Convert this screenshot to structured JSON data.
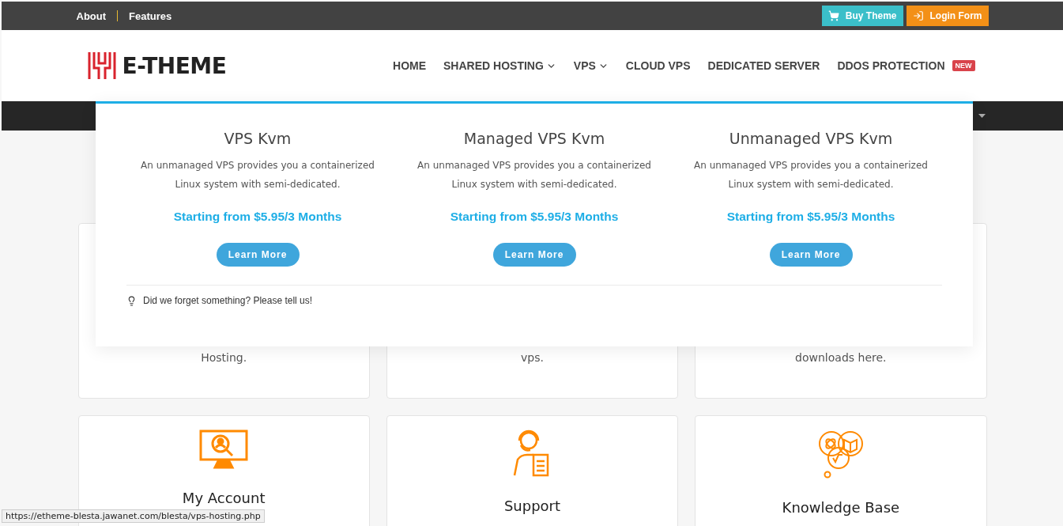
{
  "top_bar": {
    "links": [
      "About",
      "Features"
    ],
    "buttons": [
      {
        "label": "Buy Theme",
        "kind": "cart"
      },
      {
        "label": "Login Form",
        "kind": "login"
      }
    ]
  },
  "header": {
    "logo": "E-THEME",
    "nav": [
      {
        "label": "HOME",
        "dropdown": false
      },
      {
        "label": "SHARED HOSTING",
        "dropdown": true
      },
      {
        "label": "VPS",
        "dropdown": true
      },
      {
        "label": "CLOUD VPS",
        "dropdown": false
      },
      {
        "label": "DEDICATED SERVER",
        "dropdown": false
      },
      {
        "label": "DDOS PROTECTION",
        "dropdown": false,
        "badge": "NEW"
      }
    ]
  },
  "mega_menu": {
    "columns": [
      {
        "title": "VPS Kvm",
        "description_lines": [
          "An unmanaged VPS provides you a containerized",
          "Linux system with semi-dedicated."
        ],
        "price": "Starting from $5.95/3 Months",
        "button": "Learn More"
      },
      {
        "title": "Managed VPS Kvm",
        "description_lines": [
          "An unmanaged VPS provides you a containerized",
          "Linux system with semi-dedicated."
        ],
        "price": "Starting from $5.95/3 Months",
        "button": "Learn More"
      },
      {
        "title": "Unmanaged VPS Kvm",
        "description_lines": [
          "An unmanaged VPS provides you a containerized",
          "Linux system with semi-dedicated."
        ],
        "price": "Starting from $5.95/3 Months",
        "button": "Learn More"
      }
    ],
    "footer": "Did we forget something? Please tell us!"
  },
  "cards_top": [
    "Hosting.",
    "vps.",
    "downloads here."
  ],
  "cards_bottom": [
    {
      "title": "My Account",
      "kind": "account"
    },
    {
      "title": "Support",
      "kind": "support"
    },
    {
      "title": "Knowledge Base",
      "kind": "knowledge"
    }
  ],
  "status_bar": "https://etheme-blesta.jawanet.com/blesta/vps-hosting.php"
}
